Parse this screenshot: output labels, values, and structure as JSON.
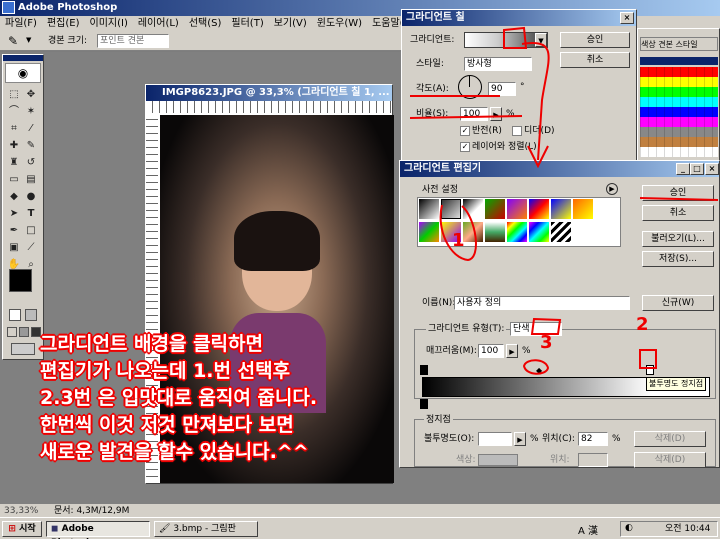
{
  "app": {
    "title": "Adobe Photoshop"
  },
  "menu": [
    "파일(F)",
    "편집(E)",
    "이미지(I)",
    "레이어(L)",
    "선택(S)",
    "필터(T)",
    "보기(V)",
    "윈도우(W)",
    "도움말(H)"
  ],
  "options_bar": {
    "label": "경본 크기:",
    "value": "포인트 견본"
  },
  "doc": {
    "title": "IMGP8623.JPG @ 33,3% (그라디언트 칠 1, ..."
  },
  "status": {
    "zoom": "33,33%",
    "doc_size": "문서: 4,3M/12,9M"
  },
  "gradient_fill": {
    "title": "그라디언트 칠",
    "gradient_label": "그라디언트:",
    "style_label": "스타일:",
    "style_value": "방사형",
    "angle_label": "각도(A):",
    "angle_value": "90",
    "angle_unit": "°",
    "scale_label": "비율(S):",
    "scale_value": "100",
    "scale_unit": "%",
    "reverse_label": "반전(R)",
    "dither_label": "디더(D)",
    "align_label": "레이어와 정렬(L)",
    "ok": "승인",
    "cancel": "취소"
  },
  "panel_tab": "색상 견본 스타일",
  "gradient_editor": {
    "title": "그라디언트 편집기",
    "presets_label": "사전 설정",
    "ok": "승인",
    "cancel": "취소",
    "load": "불러오기(L)...",
    "save": "저장(S)...",
    "name_label": "이름(N):",
    "name_value": "사용자 정의",
    "new": "신규(W)",
    "type_label": "그라디언트 유형(T):",
    "type_value": "단색",
    "smooth_label": "매끄러움(M):",
    "smooth_value": "100",
    "smooth_unit": "%",
    "stops_label": "정지점",
    "opacity_label": "불투명도(O):",
    "opacity_unit": "%",
    "location_label": "위치(C):",
    "location_value": "82",
    "location_unit": "%",
    "delete": "삭제(D)",
    "color_label": "색상:",
    "location2_label": "위치:",
    "delete2": "삭제(D)",
    "tooltip": "불투명도 정지점"
  },
  "annotations": {
    "line1": "그라디언트 배경을 클릭하면",
    "line2": "편집기가 나오는데 1.번 선택후",
    "line3": "2.3번 은 입맛대로 움직여 줍니다.",
    "line4": "한번씩 이것 저것 만져보다 보면",
    "line5": "새로운 발견을 할수 있습니다.^^",
    "num1": "1",
    "num2": "2",
    "num3": "3"
  },
  "taskbar": {
    "start": "시작",
    "task1": "Adobe Photoshop",
    "task2": "3.bmp - 그림판",
    "time": "오전 10:44",
    "ime": "A 漢"
  },
  "colors": {
    "accent_red": "#e00000",
    "titlebar": "#0a246a",
    "taskbar": "#d4d0c8"
  }
}
